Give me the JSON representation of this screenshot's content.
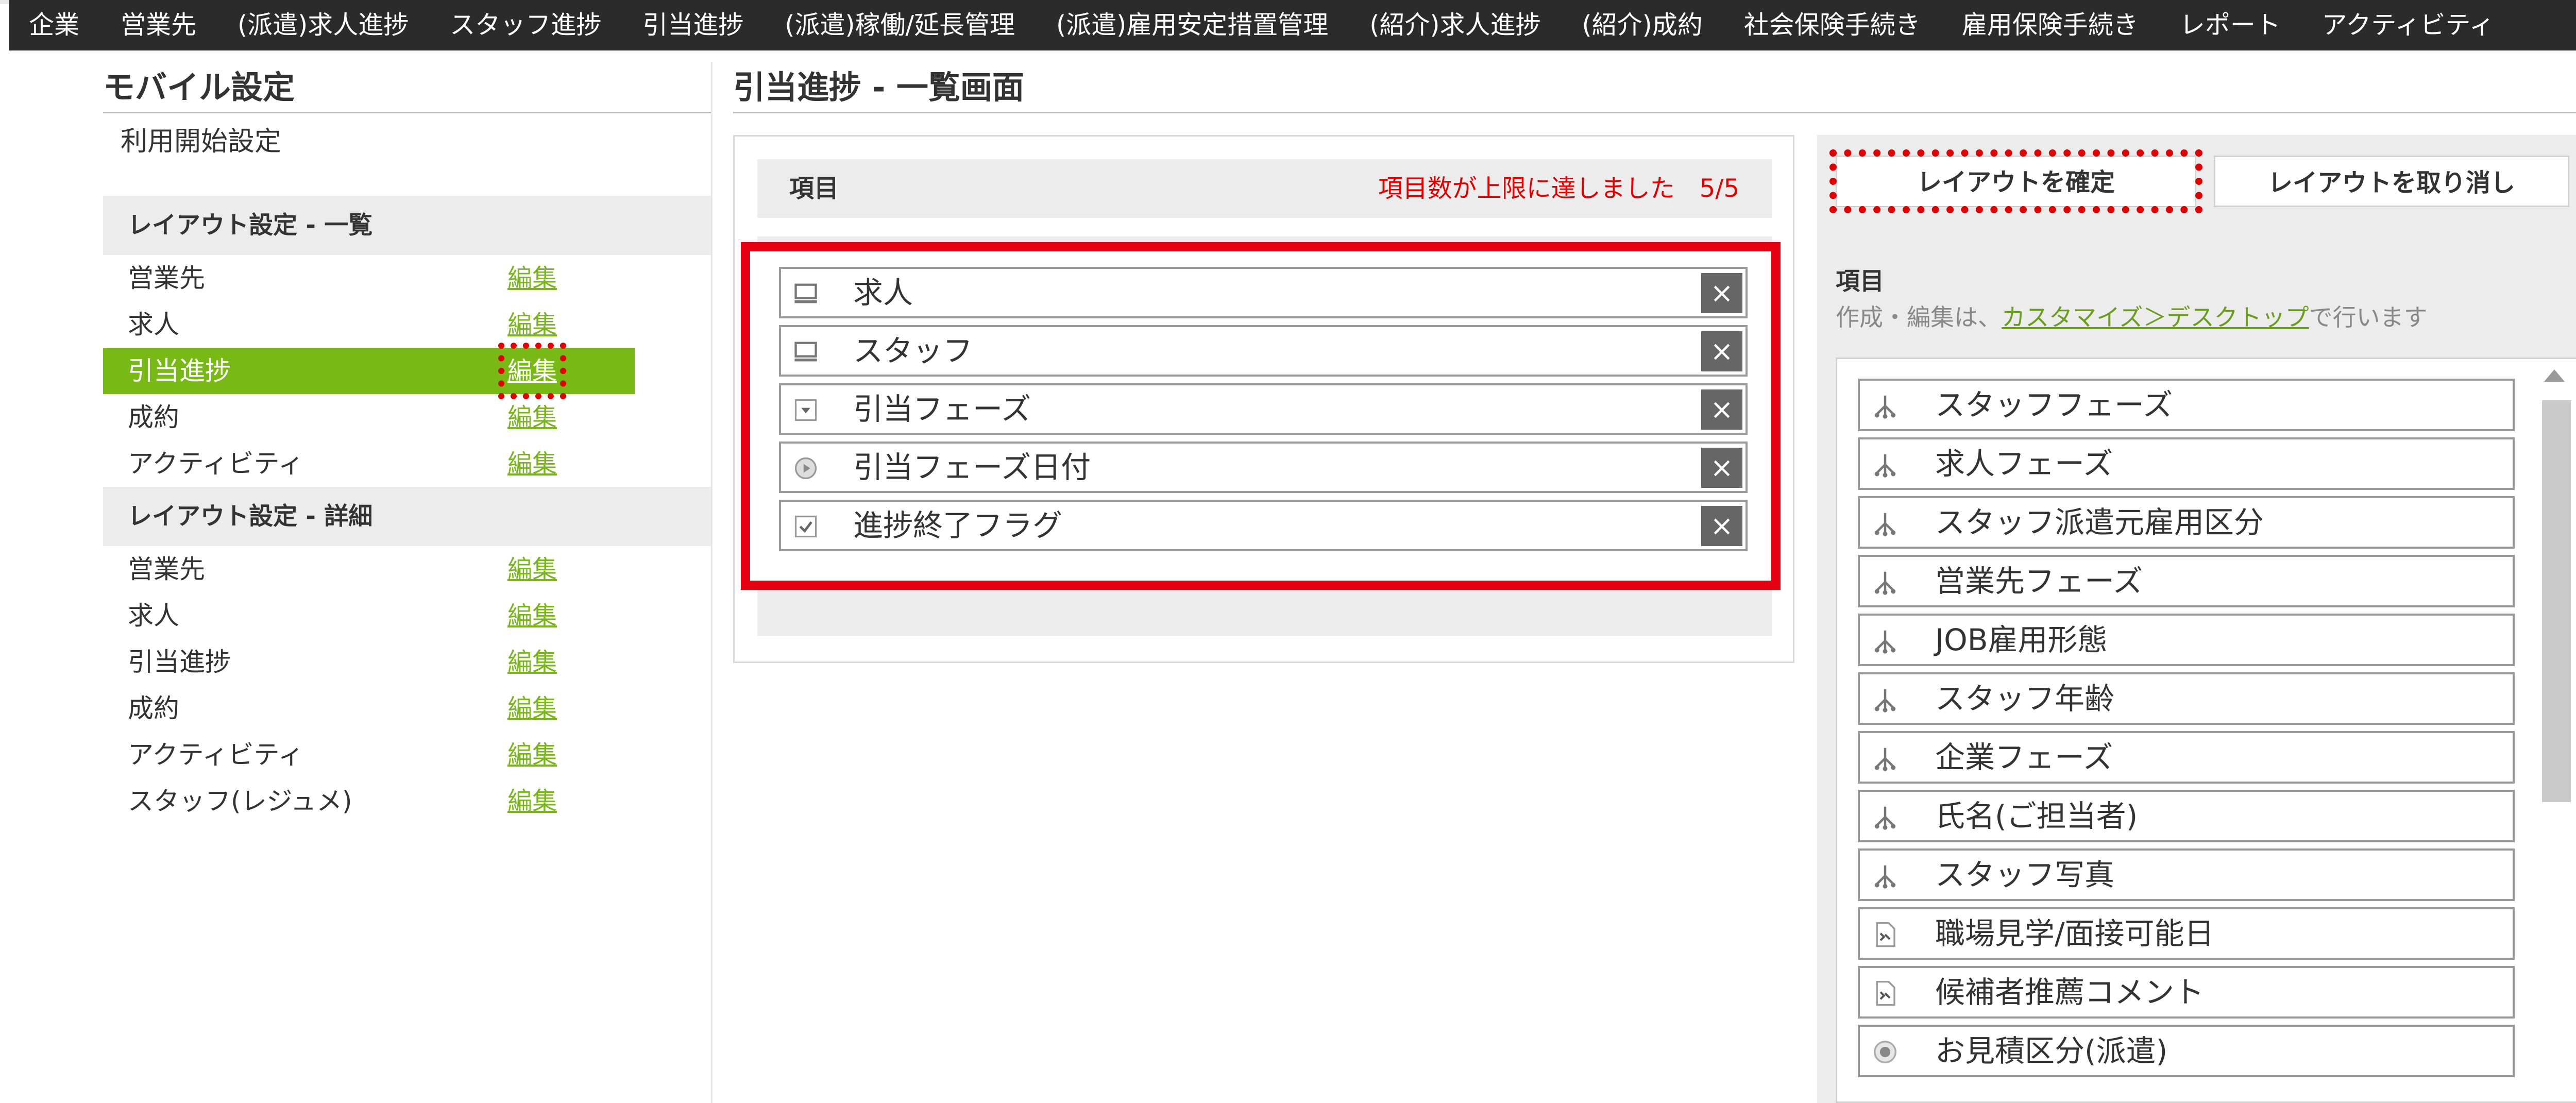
{
  "topnav": {
    "items": [
      "企業",
      "営業先",
      "(派遣)求人進捗",
      "スタッフ進捗",
      "引当進捗",
      "(派遣)稼働/延長管理",
      "(派遣)雇用安定措置管理",
      "(紹介)求人進捗",
      "(紹介)成約",
      "社会保険手続き",
      "雇用保険手続き",
      "レポート",
      "アクティビティ"
    ]
  },
  "sidebar": {
    "title": "モバイル設定",
    "start_label": "利用開始設定",
    "list_head": "レイアウト設定 - 一覧",
    "list_items": [
      {
        "label": "営業先",
        "edit": "編集"
      },
      {
        "label": "求人",
        "edit": "編集"
      },
      {
        "label": "引当進捗",
        "edit": "編集"
      },
      {
        "label": "成約",
        "edit": "編集"
      },
      {
        "label": "アクティビティ",
        "edit": "編集"
      }
    ],
    "detail_head": "レイアウト設定 - 詳細",
    "detail_items": [
      {
        "label": "営業先",
        "edit": "編集"
      },
      {
        "label": "求人",
        "edit": "編集"
      },
      {
        "label": "引当進捗",
        "edit": "編集"
      },
      {
        "label": "成約",
        "edit": "編集"
      },
      {
        "label": "アクティビティ",
        "edit": "編集"
      },
      {
        "label": "スタッフ(レジュメ)",
        "edit": "編集"
      }
    ]
  },
  "main": {
    "title": "引当進捗 - 一覧画面",
    "items_label": "項目",
    "limit_message": "項目数が上限に達しました　5/5",
    "selected": [
      {
        "label": "求人",
        "icon": "monitor-icon"
      },
      {
        "label": "スタッフ",
        "icon": "monitor-icon"
      },
      {
        "label": "引当フェーズ",
        "icon": "dropdown-icon"
      },
      {
        "label": "引当フェーズ日付",
        "icon": "clock-icon"
      },
      {
        "label": "進捗終了フラグ",
        "icon": "checkbox-icon"
      }
    ],
    "remove_symbol": "×"
  },
  "right": {
    "confirm_button": "レイアウトを確定",
    "cancel_button": "レイアウトを取り消し",
    "items_label": "項目",
    "note_prefix": "作成・編集は、",
    "note_link": "カスタマイズ＞デスクトップ",
    "note_suffix": "で行います",
    "available": [
      {
        "label": "スタッフフェーズ",
        "icon": "tree-icon"
      },
      {
        "label": "求人フェーズ",
        "icon": "tree-icon"
      },
      {
        "label": "スタッフ派遣元雇用区分",
        "icon": "tree-icon"
      },
      {
        "label": "営業先フェーズ",
        "icon": "tree-icon"
      },
      {
        "label": "JOB雇用形態",
        "icon": "tree-icon"
      },
      {
        "label": "スタッフ年齢",
        "icon": "tree-icon"
      },
      {
        "label": "企業フェーズ",
        "icon": "tree-icon"
      },
      {
        "label": "氏名(ご担当者)",
        "icon": "tree-icon"
      },
      {
        "label": "スタッフ写真",
        "icon": "tree-icon"
      },
      {
        "label": "職場見学/面接可能日",
        "icon": "document-icon"
      },
      {
        "label": "候補者推薦コメント",
        "icon": "document-icon"
      },
      {
        "label": "お見積区分(派遣)",
        "icon": "radio-icon"
      }
    ]
  },
  "colors": {
    "accent_green": "#78b916",
    "alert_red": "#e60012",
    "nav_bg": "#2b2b2b"
  }
}
